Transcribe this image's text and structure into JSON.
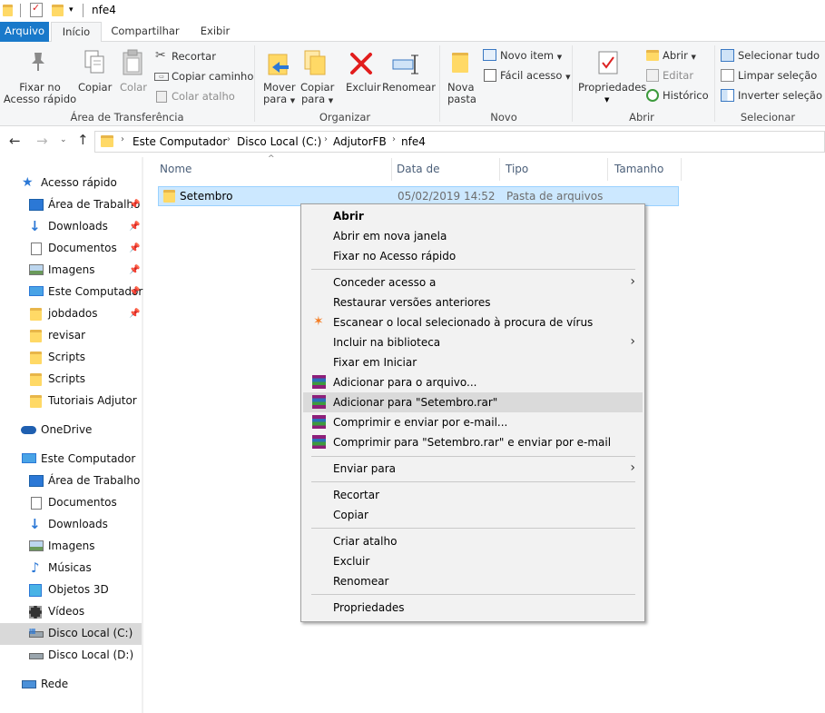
{
  "window": {
    "title": "nfe4"
  },
  "tabs": [
    "Arquivo",
    "Início",
    "Compartilhar",
    "Exibir"
  ],
  "ribbon": {
    "clipboard": {
      "pin": "Fixar no\nAcesso rápido",
      "pin_l1": "Fixar no",
      "pin_l2": "Acesso rápido",
      "copy": "Copiar",
      "paste": "Colar",
      "cut": "Recortar",
      "copy_path": "Copiar caminho",
      "paste_shortcut": "Colar atalho",
      "group": "Área de Transferência"
    },
    "organize": {
      "move_l1": "Mover",
      "move_l2": "para",
      "copy_l1": "Copiar",
      "copy_l2": "para",
      "delete": "Excluir",
      "rename": "Renomear",
      "group": "Organizar"
    },
    "new": {
      "folder_l1": "Nova",
      "folder_l2": "pasta",
      "new_item": "Novo item",
      "easy_access": "Fácil acesso",
      "group": "Novo"
    },
    "open": {
      "properties": "Propriedades",
      "open": "Abrir",
      "edit": "Editar",
      "history": "Histórico",
      "group": "Abrir"
    },
    "select": {
      "select_all": "Selecionar tudo",
      "clear": "Limpar seleção",
      "invert": "Inverter seleção",
      "group": "Selecionar"
    }
  },
  "breadcrumb": [
    "Este Computador",
    "Disco Local (C:)",
    "AdjutorFB",
    "nfe4"
  ],
  "nav": {
    "quick_access": "Acesso rápido",
    "quick_items": [
      "Área de Trabalho",
      "Downloads",
      "Documentos",
      "Imagens",
      "Este Computador",
      "jobdados",
      "revisar",
      "Scripts",
      "Scripts",
      "Tutoriais Adjutor"
    ],
    "onedrive": "OneDrive",
    "this_pc": "Este Computador",
    "pc_items": [
      "Área de Trabalho",
      "Documentos",
      "Downloads",
      "Imagens",
      "Músicas",
      "Objetos 3D",
      "Vídeos",
      "Disco Local (C:)",
      "Disco Local (D:)"
    ],
    "network": "Rede"
  },
  "columns": [
    "Nome",
    "Data de modificaç...",
    "Tipo",
    "Tamanho"
  ],
  "files": [
    {
      "name": "Setembro",
      "modified": "05/02/2019 14:52",
      "type": "Pasta de arquivos",
      "size": ""
    }
  ],
  "context_menu": [
    "Abrir",
    "Abrir em nova janela",
    "Fixar no Acesso rápido",
    "Conceder acesso a",
    "Restaurar versões anteriores",
    "Escanear o local selecionado à procura de vírus",
    "Incluir na biblioteca",
    "Fixar em Iniciar",
    "Adicionar para o arquivo...",
    "Adicionar para \"Setembro.rar\"",
    "Comprimir e enviar por e-mail...",
    "Comprimir para \"Setembro.rar\" e enviar por e-mail",
    "Enviar para",
    "Recortar",
    "Copiar",
    "Criar atalho",
    "Excluir",
    "Renomear",
    "Propriedades"
  ],
  "colors": {
    "accent": "#1979ca",
    "selection": "#cce8ff",
    "menu_highlight": "#dadada"
  }
}
